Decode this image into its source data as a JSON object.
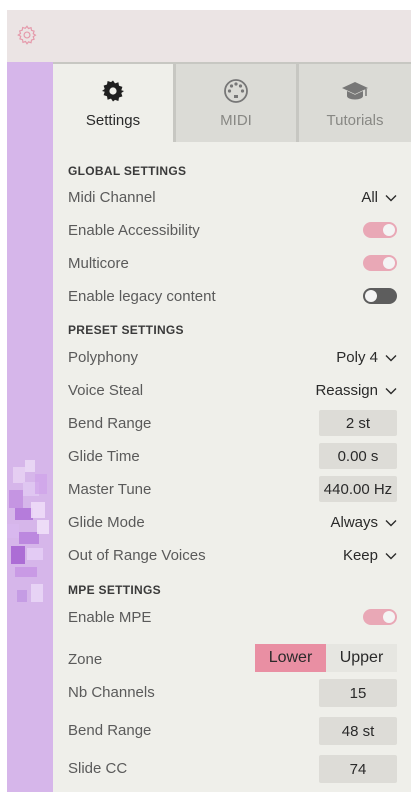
{
  "tabs": [
    {
      "label": "Settings",
      "icon": "gear-icon",
      "active": true
    },
    {
      "label": "MIDI",
      "icon": "midi-port-icon",
      "active": false
    },
    {
      "label": "Tutorials",
      "icon": "graduation-cap-icon",
      "active": false
    }
  ],
  "global": {
    "title": "GLOBAL SETTINGS",
    "midi_channel": {
      "label": "Midi Channel",
      "value": "All"
    },
    "accessibility": {
      "label": "Enable Accessibility",
      "on": true
    },
    "multicore": {
      "label": "Multicore",
      "on": true
    },
    "legacy": {
      "label": "Enable legacy content",
      "on": false
    }
  },
  "preset": {
    "title": "PRESET SETTINGS",
    "polyphony": {
      "label": "Polyphony",
      "value": "Poly 4"
    },
    "voice_steal": {
      "label": "Voice Steal",
      "value": "Reassign"
    },
    "bend_range": {
      "label": "Bend Range",
      "value": "2 st"
    },
    "glide_time": {
      "label": "Glide Time",
      "value": "0.00 s"
    },
    "master_tune": {
      "label": "Master Tune",
      "value": "440.00 Hz"
    },
    "glide_mode": {
      "label": "Glide Mode",
      "value": "Always"
    },
    "out_of_range": {
      "label": "Out of Range Voices",
      "value": "Keep"
    }
  },
  "mpe": {
    "title": "MPE SETTINGS",
    "enable": {
      "label": "Enable MPE",
      "on": true
    },
    "zone": {
      "label": "Zone",
      "options": [
        "Lower",
        "Upper"
      ],
      "selected": "Lower"
    },
    "nb_channels": {
      "label": "Nb Channels",
      "value": "15"
    },
    "bend_range": {
      "label": "Bend Range",
      "value": "48 st"
    },
    "slide_cc": {
      "label": "Slide CC",
      "value": "74"
    }
  },
  "colors": {
    "accent": "#e98fa3",
    "toggle_on": "#e9a8b6",
    "toggle_off": "#5d5d5d",
    "sidebar": "#d6b6ea",
    "panel": "#efefea"
  }
}
